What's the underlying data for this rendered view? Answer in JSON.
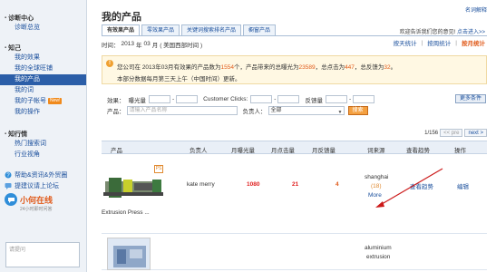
{
  "sidebar": {
    "sections": [
      {
        "title": "诊断中心",
        "items": [
          {
            "label": "诊断总览"
          }
        ]
      },
      {
        "title": "知己",
        "items": [
          {
            "label": "我的效果"
          },
          {
            "label": "我的全球旺铺"
          },
          {
            "label": "我的产品",
            "active": true
          },
          {
            "label": "我的词"
          },
          {
            "label": "我的子帐号",
            "badge": "New!"
          },
          {
            "label": "我的操作"
          }
        ]
      },
      {
        "title": "知行情",
        "items": [
          {
            "label": "热门搜索词"
          },
          {
            "label": "行业视角"
          }
        ]
      }
    ],
    "bottom_links": [
      {
        "label": "帮助&资讯&外贸圈",
        "icon": "help-icon"
      },
      {
        "label": "提建议请上论坛",
        "icon": "forum-icon"
      }
    ],
    "online": {
      "title": "小何在线",
      "subtitle": "24小时即时问答"
    },
    "ask_placeholder": "请提问"
  },
  "header": {
    "title": "我的产品",
    "help_link": "名词解释",
    "feedback_text": "欢迎告诉我们您的意见!",
    "feedback_link": "点击进入>>"
  },
  "tabs": [
    {
      "label": "有效果产品",
      "active": true
    },
    {
      "label": "零效果产品"
    },
    {
      "label": "关键词搜索排名产品"
    },
    {
      "label": "橱窗产品"
    }
  ],
  "timebar": {
    "label": "时间：",
    "year": "2013",
    "year_unit": "年",
    "month": "03",
    "month_unit": "月",
    "zone": "( 美国西部时间 )",
    "links": [
      {
        "label": "按天统计"
      },
      {
        "label": "按周统计"
      },
      {
        "label": "按月统计",
        "active": true
      }
    ]
  },
  "notice": {
    "l1_a": "您公司在",
    "l1_b": "2013年03月有效果的产品数为",
    "product_count": "1554",
    "l1_c": "个，产品带来的总曝光为",
    "exposure": "23589",
    "l1_d": "，总点击为",
    "clicks": "447",
    "l1_e": "，总反馈为",
    "feedback": "32",
    "l1_f": "。",
    "l2": "本部分数据每月第三天上午（中国时间）更新。"
  },
  "filters": {
    "label_effect": "效果：",
    "label_exposure": "曝光量",
    "label_customer_clicks": "Customer Clicks:",
    "label_feedback": "反馈量",
    "more_button": "更多条件",
    "label_product": "产品：",
    "product_placeholder": "请输入产品名称",
    "label_owner": "负责人：",
    "owner_value": "全部",
    "search_button": "搜索",
    "dash": "-"
  },
  "pager": {
    "current": "1/156",
    "prev": "<< pre",
    "next": "next >"
  },
  "table": {
    "headers": {
      "product": "产品",
      "owner": "负责人",
      "exposure": "月曝光量",
      "clicks": "月点击量",
      "feedback": "月反馈量",
      "source": "词来源",
      "trend": "查看趋势",
      "action": "操作"
    },
    "rows": [
      {
        "ps": "PS",
        "name": "Extrusion Press ...",
        "owner": "kate merry",
        "exposure": "1080",
        "clicks": "21",
        "feedback": "4",
        "source": "shanghai",
        "source_count": "(18)",
        "source_more": "More",
        "trend": "查看趋势",
        "action": "编辑"
      },
      {
        "source_l1": "aluminium",
        "source_l2": "extrusion"
      }
    ]
  },
  "colors": {
    "link": "#1a4f9c",
    "active_nav": "#2b5ea8",
    "highlight": "#e05a1a",
    "value_red": "#e02020",
    "annotation_arrow": "#cc1a1a"
  }
}
